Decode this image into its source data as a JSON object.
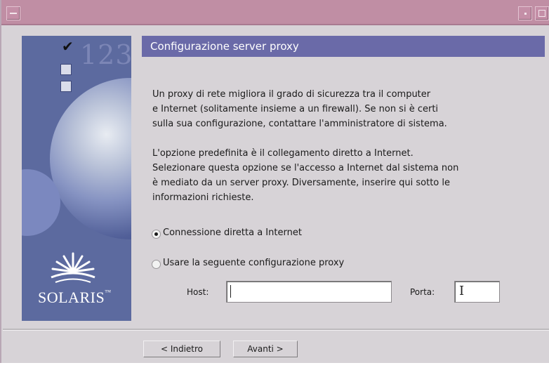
{
  "window": {
    "menu_icon": "window-menu-icon",
    "minimize_icon": "minimize-icon",
    "maximize_icon": "maximize-icon"
  },
  "sidebar": {
    "step_number": "123",
    "brand": "SOLARIS",
    "brand_mark": "™",
    "check_icon": "checkmark-icon",
    "logo_icon": "sun-logo-icon"
  },
  "header": {
    "title": "Configurazione server proxy"
  },
  "content": {
    "paragraph1": [
      "Un proxy di rete migliora il grado di sicurezza tra il computer",
      "e Internet (solitamente insieme a un firewall). Se non si è certi",
      "sulla sua configurazione, contattare l'amministratore di sistema."
    ],
    "paragraph2": [
      "L'opzione predefinita è il collegamento diretto a Internet.",
      "Selezionare questa opzione se l'accesso a Internet dal sistema non",
      "è mediato da un server proxy.  Diversamente, inserire qui sotto le",
      "informazioni richieste."
    ]
  },
  "options": {
    "direct": {
      "label": "Connessione diretta a Internet",
      "selected": true
    },
    "proxy": {
      "label": "Usare la seguente configurazione proxy",
      "selected": false
    }
  },
  "fields": {
    "host_label": "Host:",
    "host_value": "",
    "port_label": "Porta:",
    "port_value": ""
  },
  "buttons": {
    "back": "< Indietro",
    "next": "Avanti >"
  },
  "colors": {
    "titlebar": "#c08ea4",
    "header": "#6a6aa8",
    "sidebar": "#5c6a9f",
    "dialog": "#d7d3d7"
  }
}
